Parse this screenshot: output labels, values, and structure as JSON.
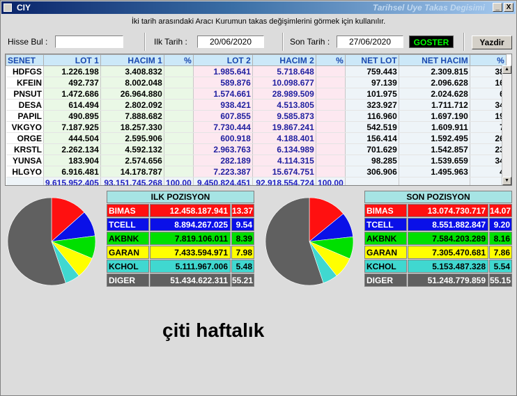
{
  "window": {
    "title_left": "CIY",
    "title_right": "Tarihsel Uye Takas Degisimi",
    "min_glyph": "_",
    "close_glyph": "X"
  },
  "info_text": "İki tarih arasındaki  Aracı Kurumun takas değişimlerini görmek için kullanılır.",
  "search": {
    "label": "Hisse Bul :",
    "value": ""
  },
  "start_date": {
    "label": "Ilk Tarih :",
    "value": "20/06/2020"
  },
  "end_date": {
    "label": "Son Tarih :",
    "value": "27/06/2020"
  },
  "buttons": {
    "show": "GOSTER",
    "print": "Yazdir"
  },
  "columns": [
    "SENET",
    "LOT 1",
    "HACIM 1",
    "%",
    "LOT 2",
    "HACIM 2",
    "%",
    "NET LOT",
    "NET HACIM",
    "%"
  ],
  "rows": [
    [
      "HDFGS",
      "1.226.198",
      "3.408.832",
      "",
      "1.985.641",
      "5.718.648",
      "",
      "759.443",
      "2.309.815",
      "38"
    ],
    [
      "KFEIN",
      "492.737",
      "8.002.048",
      "",
      "589.876",
      "10.098.677",
      "",
      "97.139",
      "2.096.628",
      "16"
    ],
    [
      "PNSUT",
      "1.472.686",
      "26.964.880",
      "",
      "1.574.661",
      "28.989.509",
      "",
      "101.975",
      "2.024.628",
      "6"
    ],
    [
      "DESA",
      "614.494",
      "2.802.092",
      "",
      "938.421",
      "4.513.805",
      "",
      "323.927",
      "1.711.712",
      "34"
    ],
    [
      "PAPIL",
      "490.895",
      "7.888.682",
      "",
      "607.855",
      "9.585.873",
      "",
      "116.960",
      "1.697.190",
      "19"
    ],
    [
      "VKGYO",
      "7.187.925",
      "18.257.330",
      "",
      "7.730.444",
      "19.867.241",
      "",
      "542.519",
      "1.609.911",
      "7"
    ],
    [
      "ORGE",
      "444.504",
      "2.595.906",
      "",
      "600.918",
      "4.188.401",
      "",
      "156.414",
      "1.592.495",
      "26"
    ],
    [
      "KRSTL",
      "2.262.134",
      "4.592.132",
      "",
      "2.963.763",
      "6.134.989",
      "",
      "701.629",
      "1.542.857",
      "23"
    ],
    [
      "YUNSA",
      "183.904",
      "2.574.656",
      "",
      "282.189",
      "4.114.315",
      "",
      "98.285",
      "1.539.659",
      "34"
    ],
    [
      "HLGYO",
      "6.916.481",
      "14.178.787",
      "",
      "7.223.387",
      "15.674.751",
      "",
      "306.906",
      "1.495.963",
      "4"
    ]
  ],
  "totals": [
    "",
    "9.615.952.405",
    "93.151.745.268",
    "100,00",
    "9.450.824.451",
    "92.918.554.724",
    "100,00",
    "",
    "",
    ""
  ],
  "ilk_pozisyon": {
    "title": "ILK POZISYON",
    "items": [
      {
        "code": "BIMAS",
        "value": "12.458.187.941",
        "pct": "13.37",
        "share": 13.37,
        "color": "#ff1010",
        "text": "#ffffff"
      },
      {
        "code": "TCELL",
        "value": "8.894.267.025",
        "pct": "9.54",
        "share": 9.54,
        "color": "#0a10e8",
        "text": "#ffffff"
      },
      {
        "code": "AKBNK",
        "value": "7.819.106.011",
        "pct": "8.39",
        "share": 8.39,
        "color": "#00e000",
        "text": "#000000"
      },
      {
        "code": "GARAN",
        "value": "7.433.594.971",
        "pct": "7.98",
        "share": 7.98,
        "color": "#ffff00",
        "text": "#000000"
      },
      {
        "code": "KCHOL",
        "value": "5.111.967.006",
        "pct": "5.48",
        "share": 5.48,
        "color": "#40d8d0",
        "text": "#000000"
      },
      {
        "code": "DIGER",
        "value": "51.434.622.311",
        "pct": "55.21",
        "share": 55.21,
        "color": "#606060",
        "text": "#ffffff"
      }
    ]
  },
  "son_pozisyon": {
    "title": "SON POZISYON",
    "items": [
      {
        "code": "BIMAS",
        "value": "13.074.730.717",
        "pct": "14.07",
        "share": 14.07,
        "color": "#ff1010",
        "text": "#ffffff"
      },
      {
        "code": "TCELL",
        "value": "8.551.882.847",
        "pct": "9.20",
        "share": 9.2,
        "color": "#0a10e8",
        "text": "#ffffff"
      },
      {
        "code": "AKBNK",
        "value": "7.584.203.289",
        "pct": "8.16",
        "share": 8.16,
        "color": "#00e000",
        "text": "#000000"
      },
      {
        "code": "GARAN",
        "value": "7.305.470.681",
        "pct": "7.86",
        "share": 7.86,
        "color": "#ffff00",
        "text": "#000000"
      },
      {
        "code": "KCHOL",
        "value": "5.153.487.328",
        "pct": "5.54",
        "share": 5.54,
        "color": "#40d8d0",
        "text": "#000000"
      },
      {
        "code": "DIGER",
        "value": "51.248.779.859",
        "pct": "55.15",
        "share": 55.15,
        "color": "#606060",
        "text": "#ffffff"
      }
    ]
  },
  "caption": "çiti haftalık"
}
